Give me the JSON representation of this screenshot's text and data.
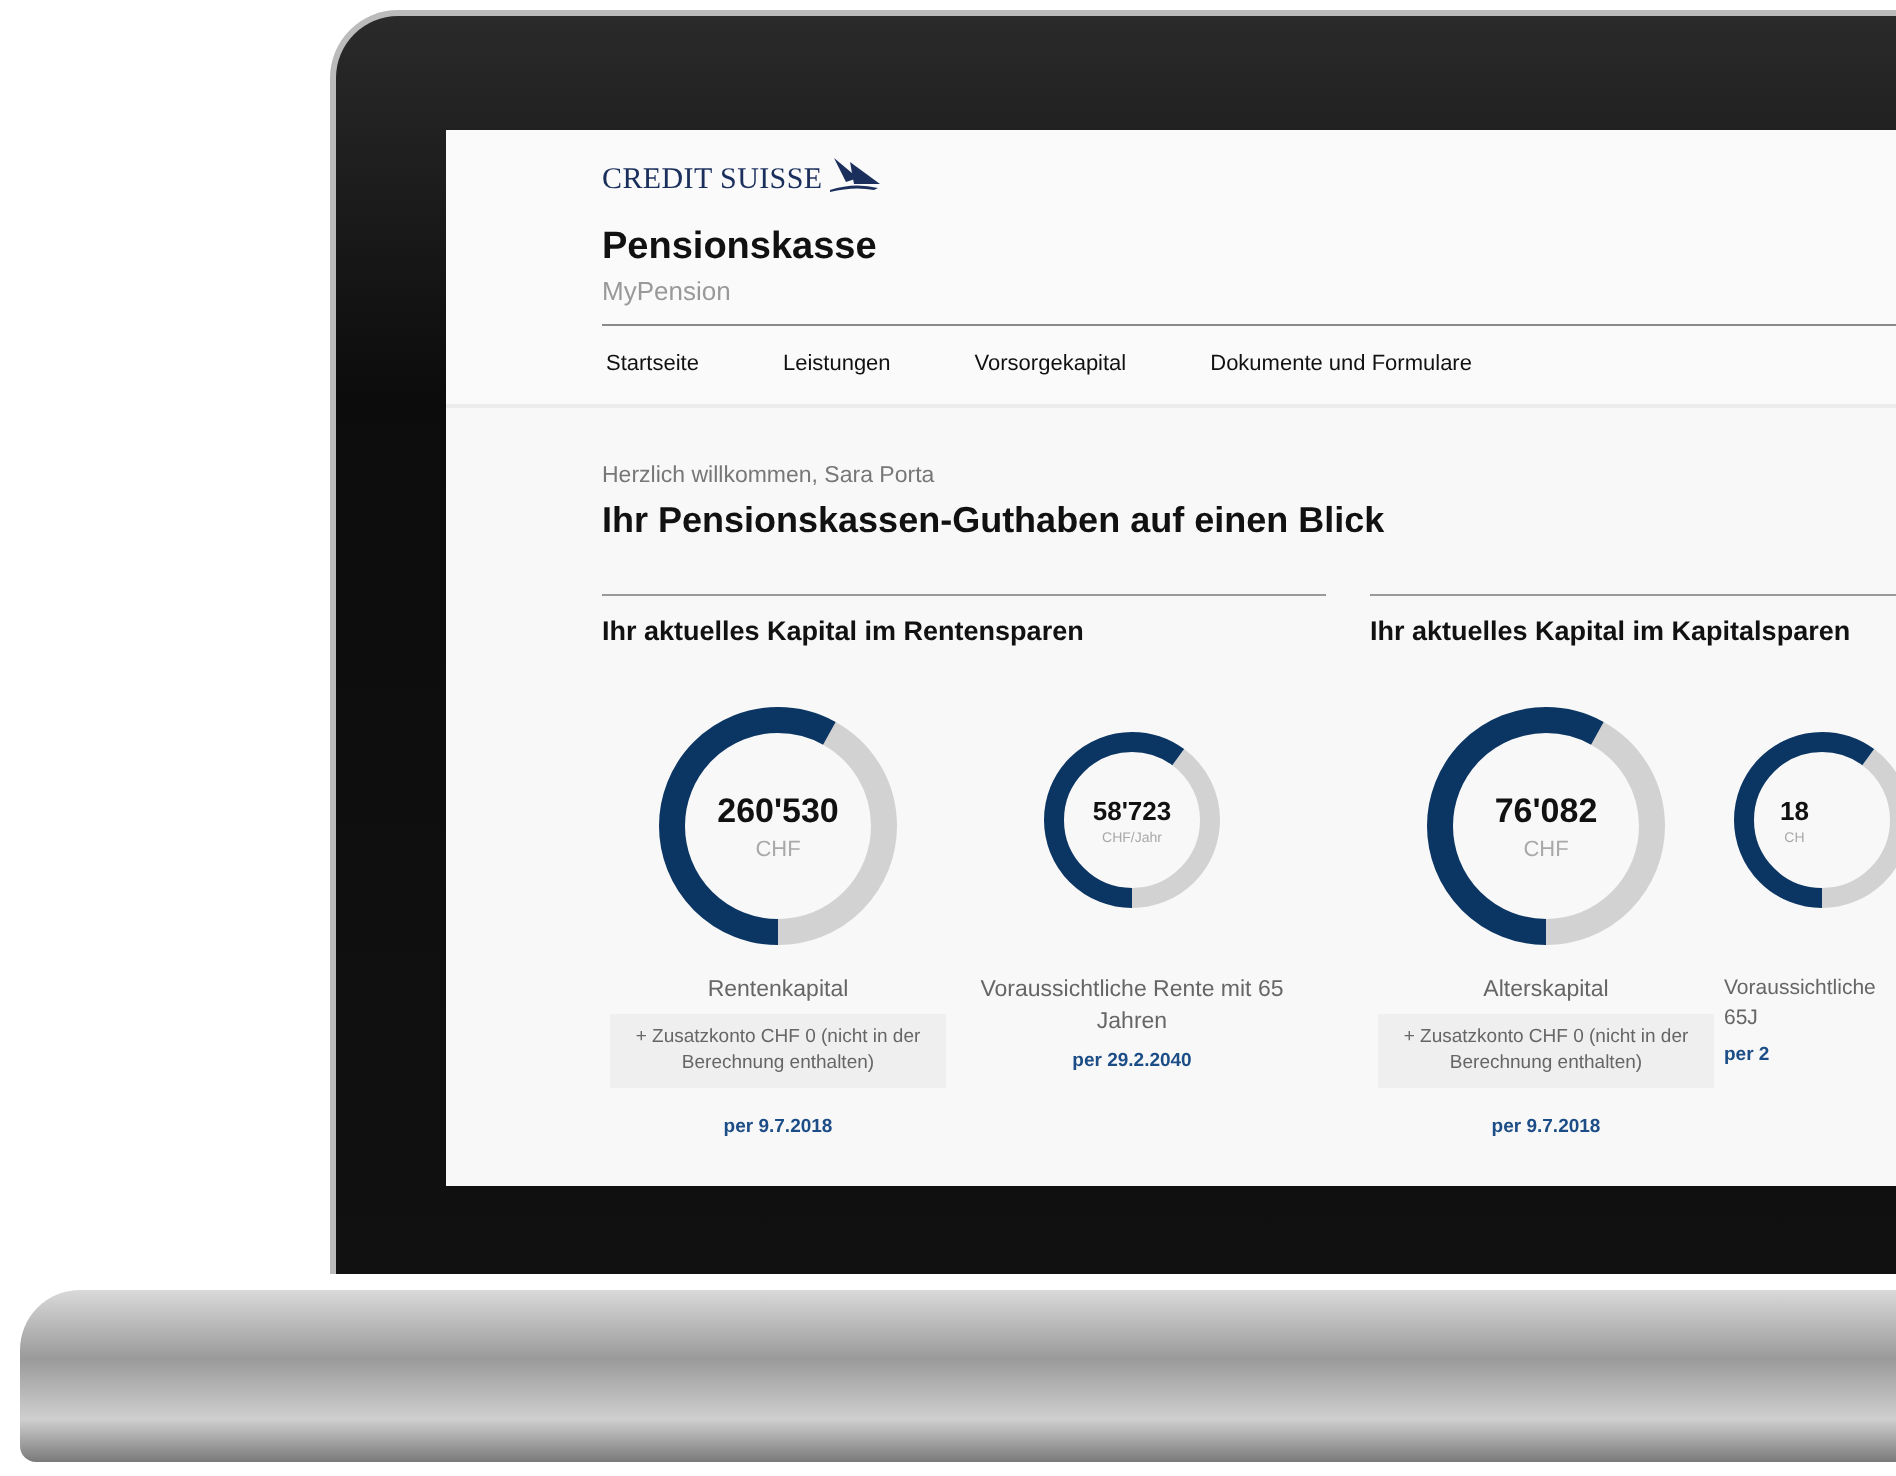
{
  "brand": {
    "name": "CREDIT SUISSE"
  },
  "header": {
    "title": "Pensionskasse",
    "subtitle": "MyPension"
  },
  "nav": [
    {
      "label": "Startseite"
    },
    {
      "label": "Leistungen"
    },
    {
      "label": "Vorsorgekapital"
    },
    {
      "label": "Dokumente und Formulare"
    }
  ],
  "greeting": "Herzlich willkommen, Sara Porta",
  "headline": "Ihr Pensionskassen-Guthaben auf einen Blick",
  "sections": [
    {
      "title": "Ihr aktuelles Kapital im Rentensparen",
      "cards": [
        {
          "kind": "capital",
          "level": 0.58,
          "value": "260'530",
          "unit": "CHF",
          "label": "Rentenkapital",
          "note": "+ Zusatzkonto CHF 0 (nicht in der Berechnung enthalten)",
          "date": "per 9.7.2018"
        },
        {
          "kind": "pension",
          "level": 0.6,
          "value": "58'723",
          "unit": "CHF/Jahr",
          "label": "Voraussichtliche Rente mit 65 Jahren",
          "date": "per 29.2.2040"
        }
      ]
    },
    {
      "title": "Ihr aktuelles Kapital im Kapitalsparen",
      "cards": [
        {
          "kind": "capital",
          "level": 0.58,
          "value": "76'082",
          "unit": "CHF",
          "label": "Alterskapital",
          "note": "+ Zusatzkonto CHF 0 (nicht in der Berechnung enthalten)",
          "date": "per 9.7.2018"
        },
        {
          "kind": "pension",
          "level": 0.6,
          "value": "18",
          "unit": "CH",
          "label": "Voraussichtliche 65J",
          "date": "per 2"
        }
      ]
    }
  ]
}
